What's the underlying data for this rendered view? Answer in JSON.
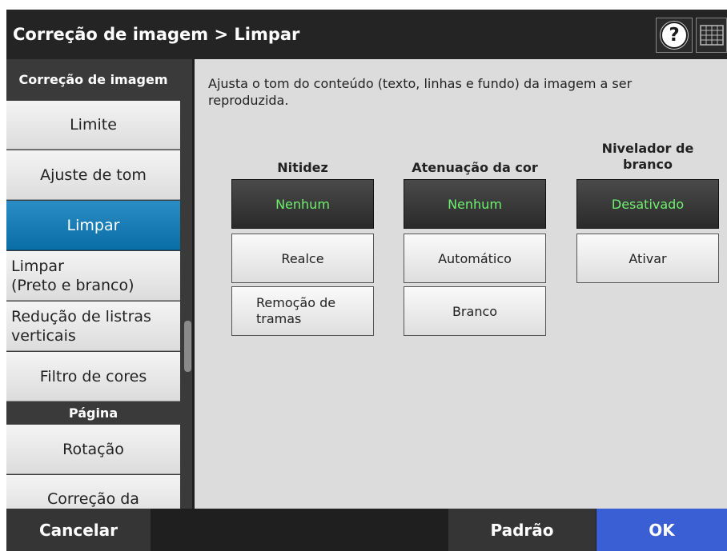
{
  "title": "Correção de imagem > Limpar",
  "header": {
    "help_icon": "?",
    "keyboard_icon": "keyboard-icon"
  },
  "sidebar": {
    "section_image": "Correção de imagem",
    "items": [
      {
        "label": "Limite"
      },
      {
        "label": "Ajuste de tom"
      },
      {
        "label": "Limpar",
        "selected": true
      },
      {
        "label": "Limpar\n(Preto e branco)"
      },
      {
        "label": "Redução de listras verticais"
      },
      {
        "label": "Filtro de cores"
      }
    ],
    "section_page": "Página",
    "page_items": [
      {
        "label": "Rotação"
      },
      {
        "label": "Correção da"
      }
    ]
  },
  "main": {
    "description": "Ajusta o tom do conteúdo (texto, linhas e fundo) da imagem a ser reproduzida.",
    "columns": [
      {
        "header": "Nitidez",
        "options": [
          "Nenhum",
          "Realce",
          "Remoção de tramas"
        ],
        "selected": "Nenhum"
      },
      {
        "header": "Atenuação da cor",
        "options": [
          "Nenhum",
          "Automático",
          "Branco"
        ],
        "selected": "Nenhum"
      },
      {
        "header": "Nivelador de branco",
        "options": [
          "Desativado",
          "Ativar"
        ],
        "selected": "Desativado"
      }
    ]
  },
  "footer": {
    "cancel_label": "Cancelar",
    "default_label": "Padrão",
    "ok_label": "OK"
  },
  "colors": {
    "selected_tab": "#0a6ea6",
    "selected_option_text": "#6ef06e",
    "ok_button": "#3a5fd4"
  }
}
